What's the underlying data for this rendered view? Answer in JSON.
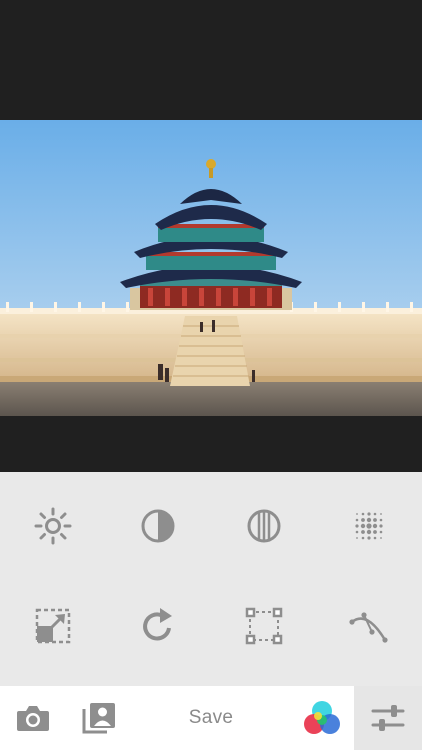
{
  "editor": {
    "photo": {
      "subject": "temple-photo"
    },
    "tools_row1": [
      {
        "name": "brightness-icon"
      },
      {
        "name": "contrast-icon"
      },
      {
        "name": "saturation-icon"
      },
      {
        "name": "vignette-icon"
      }
    ],
    "tools_row2": [
      {
        "name": "crop-resize-icon"
      },
      {
        "name": "rotate-icon"
      },
      {
        "name": "perspective-icon"
      },
      {
        "name": "curves-icon"
      }
    ]
  },
  "bottom_bar": {
    "camera_icon": "camera-icon",
    "gallery_icon": "gallery-icon",
    "save_label": "Save",
    "filters_icon": "color-filters-icon",
    "adjust_icon": "adjust-sliders-icon"
  },
  "colors": {
    "icon_gray": "#8e8e8e",
    "tools_bg": "#e9e9e9",
    "canvas_bg": "#202020",
    "filter_cyan": "#36d3e0",
    "filter_yellow": "#f2df3a",
    "filter_red": "#e8324a",
    "filter_green": "#27c46a",
    "filter_blue": "#2a6bd6"
  }
}
